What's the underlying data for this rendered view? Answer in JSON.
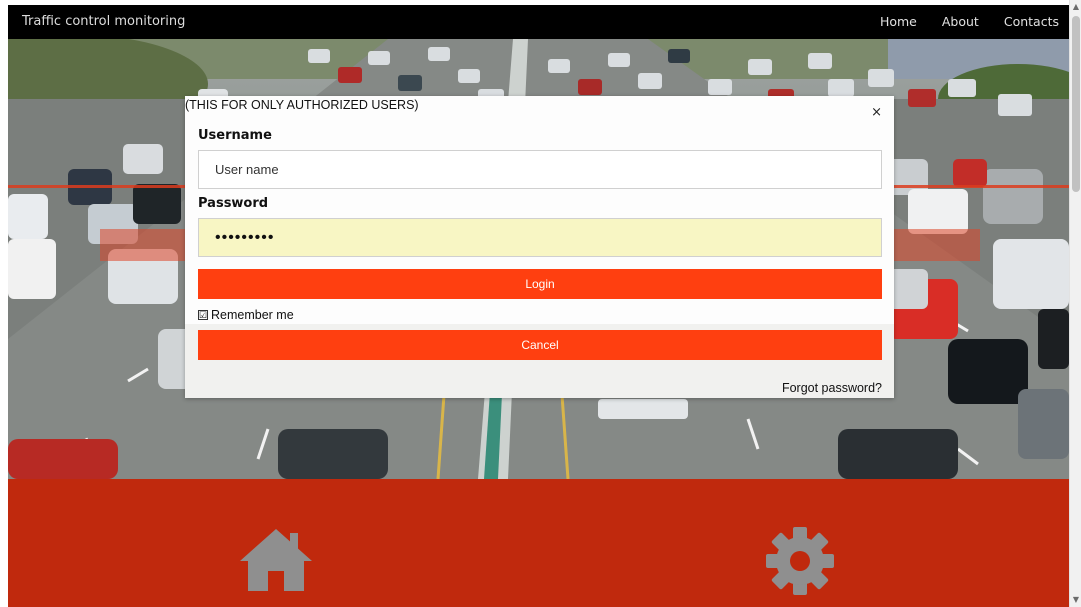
{
  "header": {
    "brand": "Traffic control monitoring",
    "nav": [
      {
        "label": "Home"
      },
      {
        "label": "About"
      },
      {
        "label": "Contacts"
      }
    ]
  },
  "modal": {
    "title": "(THIS FOR ONLY AUTHORIZED USERS)",
    "close": "×",
    "username_label": "Username",
    "username_value": "User name",
    "password_label": "Password",
    "password_value": "•••••••••",
    "login_label": "Login",
    "remember_checked": "☑",
    "remember_label": "Remember me",
    "cancel_label": "Cancel",
    "forgot_label": "Forgot password?"
  },
  "features": [
    {
      "icon": "home-icon"
    },
    {
      "icon": "gear-icon"
    }
  ],
  "colors": {
    "accent": "#ff3f10",
    "footer": "#c0290d",
    "icon": "#8f8f8f"
  }
}
